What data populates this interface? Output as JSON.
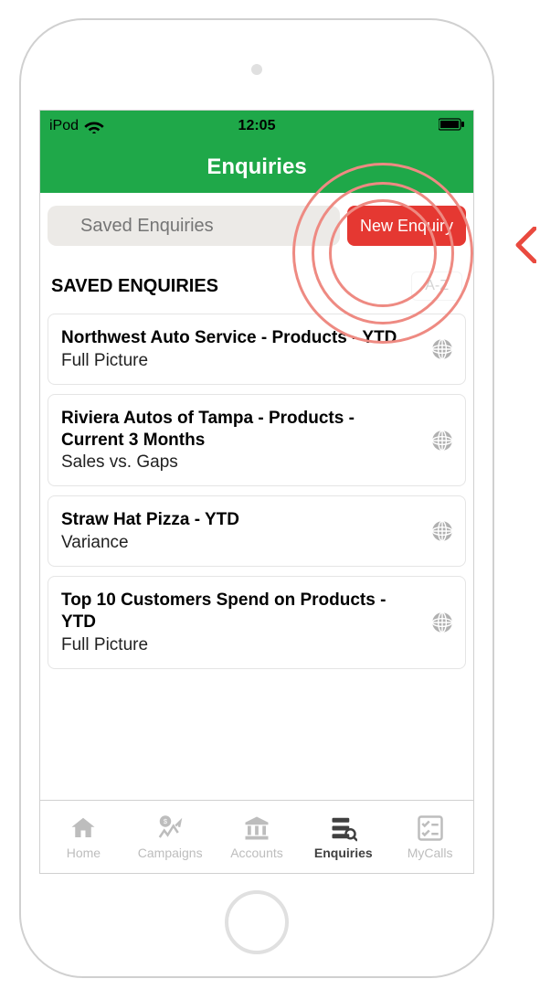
{
  "status": {
    "carrier": "iPod",
    "time": "12:05"
  },
  "header": {
    "title": "Enquiries"
  },
  "search": {
    "placeholder": "Saved Enquiries",
    "new_label": "New Enquiry"
  },
  "section": {
    "heading": "SAVED ENQUIRIES",
    "sort": "A-Z"
  },
  "items": [
    {
      "title": "Northwest Auto Service - Products - YTD",
      "subtitle": "Full Picture"
    },
    {
      "title": "Riviera Autos of Tampa - Products - Current 3 Months",
      "subtitle": "Sales vs. Gaps"
    },
    {
      "title": "Straw Hat Pizza - YTD",
      "subtitle": "Variance"
    },
    {
      "title": "Top 10 Customers Spend on Products - YTD",
      "subtitle": "Full Picture"
    }
  ],
  "tabs": [
    {
      "label": "Home"
    },
    {
      "label": "Campaigns"
    },
    {
      "label": "Accounts"
    },
    {
      "label": "Enquiries"
    },
    {
      "label": "MyCalls"
    }
  ]
}
